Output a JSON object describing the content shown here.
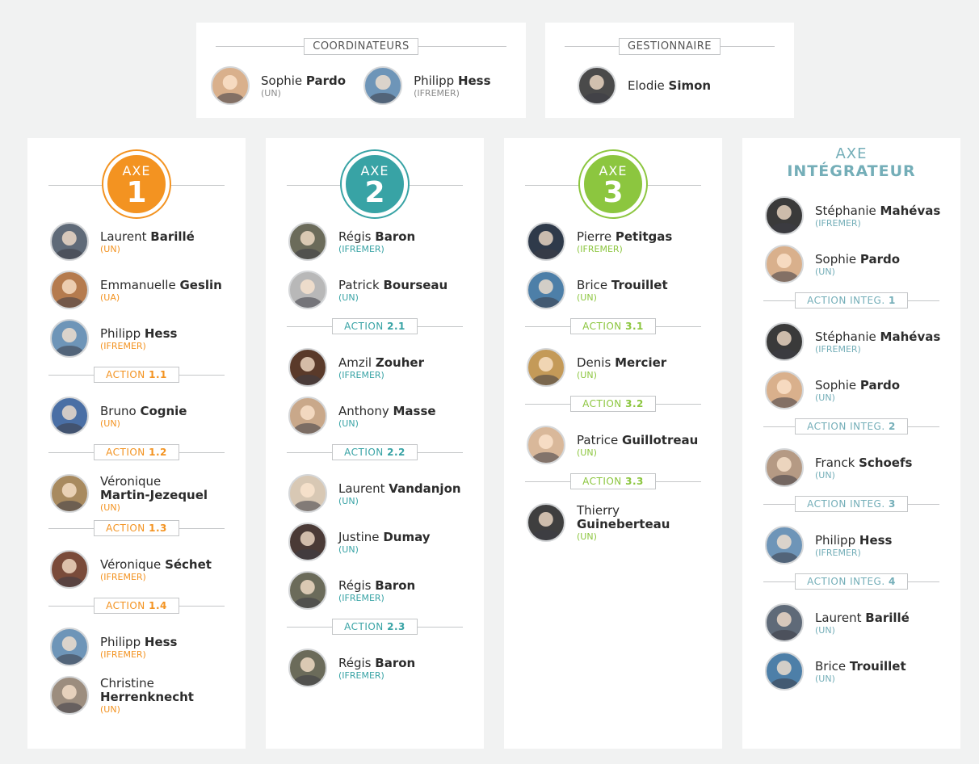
{
  "top": {
    "coord": {
      "label": "COORDINATEURS",
      "people": [
        {
          "first": "Sophie",
          "last": "Pardo",
          "org": "(UN)"
        },
        {
          "first": "Philipp",
          "last": "Hess",
          "org": "(IFREMER)"
        }
      ]
    },
    "gest": {
      "label": "GESTIONNAIRE",
      "people": [
        {
          "first": "Elodie",
          "last": "Simon",
          "org": ""
        }
      ]
    }
  },
  "colors": {
    "axe1": "#f39321",
    "axe2": "#38a3a5",
    "axe3": "#8cc63f",
    "integ": "#74aeb8",
    "action_num": "#2e2e2e"
  },
  "axes": [
    {
      "badge_word": "AXE",
      "badge_num": "1",
      "people": [
        {
          "first": "Laurent",
          "last": "Barillé",
          "org": "(UN)"
        },
        {
          "first": "Emmanuelle",
          "last": "Geslin",
          "org": "(UA)"
        },
        {
          "first": "Philipp ",
          "last": "Hess",
          "org": "(IFREMER)"
        }
      ],
      "actions": [
        {
          "word": "ACTION",
          "num": "1.1",
          "people": [
            {
              "first": "Bruno",
              "last": "Cognie",
              "org": "(UN)"
            }
          ]
        },
        {
          "word": "ACTION",
          "num": "1.2",
          "people": [
            {
              "first": "Véronique",
              "last": "Martin-Jezequel",
              "org": "(UN)"
            }
          ]
        },
        {
          "word": "ACTION",
          "num": "1.3",
          "people": [
            {
              "first": "Véronique",
              "last": "Séchet",
              "org": "(IFREMER)"
            }
          ]
        },
        {
          "word": "ACTION",
          "num": "1.4",
          "people": [
            {
              "first": "Philipp",
              "last": "Hess",
              "org": "(IFREMER)"
            },
            {
              "first": "Christine",
              "last": "Herrenknecht",
              "org": "(UN)"
            }
          ]
        }
      ]
    },
    {
      "badge_word": "AXE",
      "badge_num": "2",
      "people": [
        {
          "first": "Régis",
          "last": "Baron",
          "org": "(IFREMER)"
        },
        {
          "first": "Patrick",
          "last": "Bourseau",
          "org": "(UN)"
        }
      ],
      "actions": [
        {
          "word": "ACTION",
          "num": "2.1",
          "people": [
            {
              "first": "Amzil",
              "last": "Zouher",
              "org": "(IFREMER)"
            },
            {
              "first": "Anthony",
              "last": "Masse",
              "org": "(UN)"
            }
          ]
        },
        {
          "word": "ACTION",
          "num": "2.2",
          "people": [
            {
              "first": "Laurent",
              "last": "Vandanjon",
              "org": "(UN)"
            },
            {
              "first": "Justine",
              "last": "Dumay",
              "org": "(UN)"
            },
            {
              "first": "Régis",
              "last": "Baron",
              "org": "(IFREMER)"
            }
          ]
        },
        {
          "word": "ACTION",
          "num": "2.3",
          "people": [
            {
              "first": "Régis",
              "last": "Baron",
              "org": "(IFREMER)"
            }
          ]
        }
      ]
    },
    {
      "badge_word": "AXE",
      "badge_num": "3",
      "people": [
        {
          "first": "Pierre",
          "last": "Petitgas",
          "org": "(IFREMER)"
        },
        {
          "first": "Brice",
          "last": "Trouillet",
          "org": "(UN)"
        }
      ],
      "actions": [
        {
          "word": "ACTION",
          "num": "3.1",
          "people": [
            {
              "first": "Denis",
              "last": "Mercier",
              "org": "(UN)"
            }
          ]
        },
        {
          "word": "ACTION",
          "num": "3.2",
          "people": [
            {
              "first": "Patrice",
              "last": "Guillotreau",
              "org": "(UN)"
            }
          ]
        },
        {
          "word": "ACTION",
          "num": "3.3",
          "people": [
            {
              "first": "Thierry",
              "last": "Guineberteau",
              "org": "(UN)"
            }
          ]
        }
      ]
    },
    {
      "title_word": "AXE",
      "title_main": "INTÉGRATEUR",
      "people": [
        {
          "first": "Stéphanie",
          "last": "Mahévas",
          "org": "(IFREMER)"
        },
        {
          "first": "Sophie",
          "last": "Pardo",
          "org": "(UN)"
        }
      ],
      "actions": [
        {
          "word": "ACTION INTEG.",
          "num": "1",
          "people": [
            {
              "first": "Stéphanie",
              "last": "Mahévas",
              "org": "(IFREMER)"
            },
            {
              "first": "Sophie",
              "last": "Pardo",
              "org": "(UN)"
            }
          ]
        },
        {
          "word": "ACTION INTEG.",
          "num": "2",
          "people": [
            {
              "first": "Franck",
              "last": "Schoefs",
              "org": "(UN)"
            }
          ]
        },
        {
          "word": "ACTION INTEG.",
          "num": "3",
          "people": [
            {
              "first": "Philipp",
              "last": "Hess",
              "org": "(IFREMER)"
            }
          ]
        },
        {
          "word": "ACTION INTEG.",
          "num": "4",
          "people": [
            {
              "first": "Laurent",
              "last": "Barillé",
              "org": "(UN)"
            },
            {
              "first": "Brice",
              "last": "Trouillet",
              "org": "(UN)"
            }
          ]
        }
      ]
    }
  ]
}
